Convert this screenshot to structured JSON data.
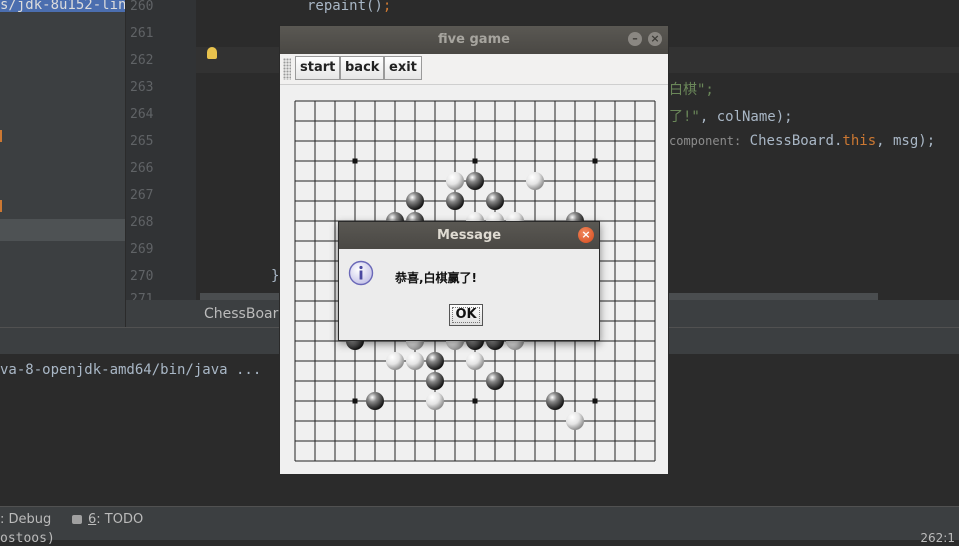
{
  "ide": {
    "left_path": "s/jdk-8u152-linux",
    "line_numbers": [
      "260",
      "261",
      "262",
      "263",
      "264",
      "265",
      "266",
      "267",
      "268",
      "269",
      "270",
      "271"
    ],
    "code": {
      "l260": "repaint()",
      "l260_semi": ";",
      "l263_str": "白棋\";",
      "l264_str": "了!\"",
      "l264_rest": ", colName);",
      "l265_hint": "component:",
      "l265_a": " ChessBoard.",
      "l265_kw": "this",
      "l265_b": ", msg);",
      "l270": "}"
    },
    "editor_tab": "ChessBoar",
    "console_cmd": "va-8-openjdk-amd64/bin/java ...",
    "status_debug": ": Debug",
    "status_todo_num": "6",
    "status_todo": ": TODO",
    "status_bottom": "ostoos)",
    "status_pos": "262:1"
  },
  "game_window": {
    "title": "five game",
    "toolbar": {
      "start_label": "start",
      "back_label": "back",
      "exit_label": "exit"
    }
  },
  "board": {
    "size": 19,
    "star_points": [
      [
        3,
        3
      ],
      [
        3,
        9
      ],
      [
        3,
        15
      ],
      [
        15,
        3
      ],
      [
        15,
        9
      ],
      [
        15,
        15
      ]
    ],
    "stones": [
      {
        "row": 4,
        "col": 8,
        "color": "white"
      },
      {
        "row": 4,
        "col": 9,
        "color": "black"
      },
      {
        "row": 4,
        "col": 12,
        "color": "white"
      },
      {
        "row": 5,
        "col": 6,
        "color": "black"
      },
      {
        "row": 5,
        "col": 8,
        "color": "black"
      },
      {
        "row": 5,
        "col": 10,
        "color": "black"
      },
      {
        "row": 6,
        "col": 5,
        "color": "black"
      },
      {
        "row": 6,
        "col": 6,
        "color": "black"
      },
      {
        "row": 6,
        "col": 9,
        "color": "white"
      },
      {
        "row": 6,
        "col": 10,
        "color": "white"
      },
      {
        "row": 6,
        "col": 11,
        "color": "white"
      },
      {
        "row": 6,
        "col": 14,
        "color": "black"
      },
      {
        "row": 12,
        "col": 3,
        "color": "black"
      },
      {
        "row": 12,
        "col": 6,
        "color": "white"
      },
      {
        "row": 12,
        "col": 8,
        "color": "white"
      },
      {
        "row": 12,
        "col": 9,
        "color": "black"
      },
      {
        "row": 12,
        "col": 10,
        "color": "black"
      },
      {
        "row": 12,
        "col": 11,
        "color": "white"
      },
      {
        "row": 13,
        "col": 5,
        "color": "white"
      },
      {
        "row": 13,
        "col": 6,
        "color": "white"
      },
      {
        "row": 13,
        "col": 7,
        "color": "black"
      },
      {
        "row": 13,
        "col": 9,
        "color": "white"
      },
      {
        "row": 14,
        "col": 7,
        "color": "black"
      },
      {
        "row": 14,
        "col": 10,
        "color": "black"
      },
      {
        "row": 15,
        "col": 4,
        "color": "black"
      },
      {
        "row": 15,
        "col": 7,
        "color": "white"
      },
      {
        "row": 15,
        "col": 13,
        "color": "black"
      },
      {
        "row": 16,
        "col": 14,
        "color": "white"
      }
    ]
  },
  "dialog": {
    "title": "Message",
    "close_label": "×",
    "message": "恭喜,白棋赢了!",
    "ok_label": "OK"
  }
}
